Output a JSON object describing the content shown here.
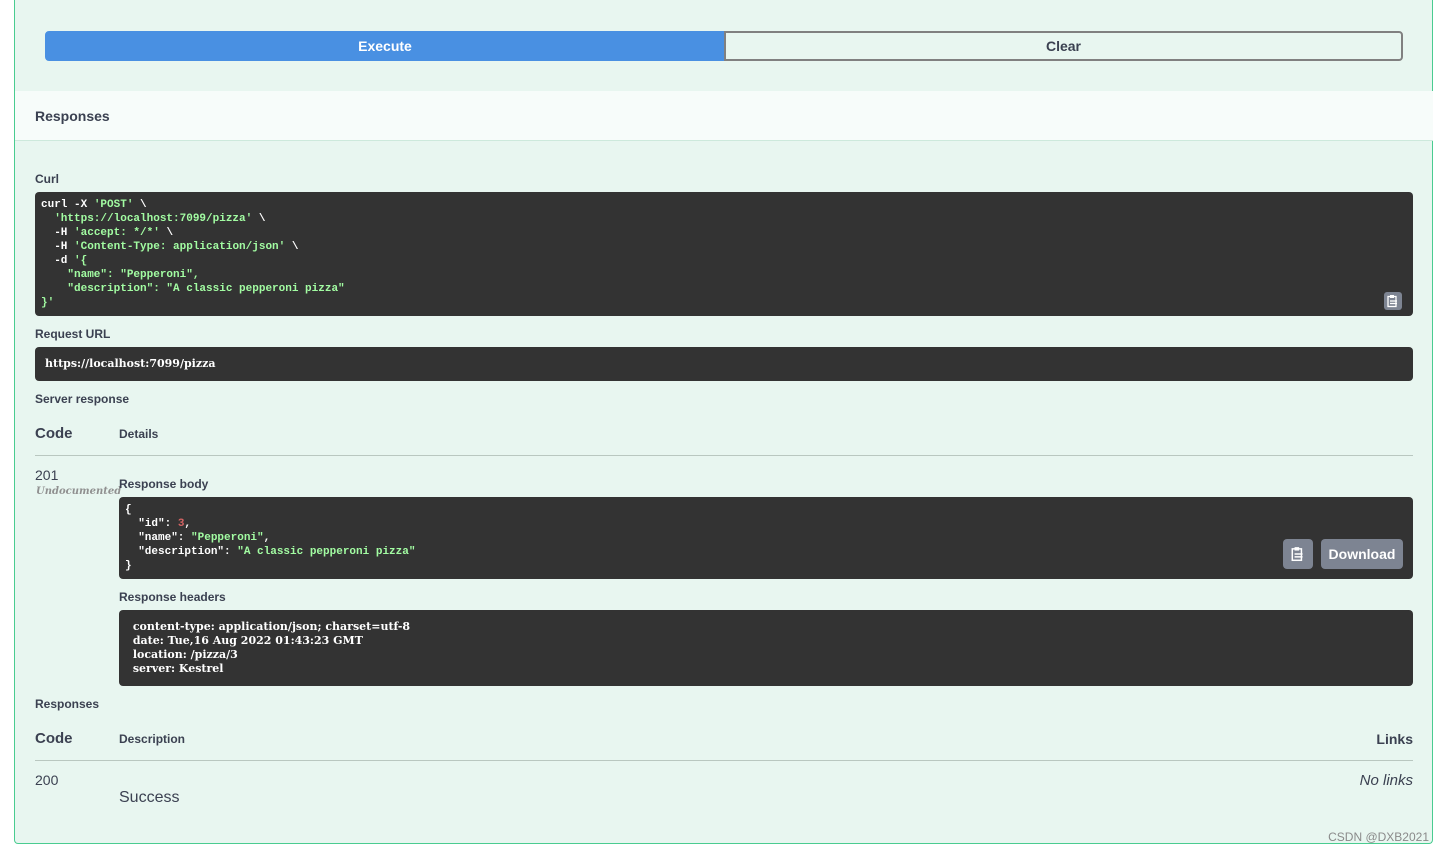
{
  "buttons": {
    "execute": "Execute",
    "clear": "Clear"
  },
  "responses_header": "Responses",
  "curl": {
    "label": "Curl",
    "lines": [
      [
        "curl -X ",
        {
          "s": "'POST'"
        },
        " \\"
      ],
      [
        "  ",
        {
          "s": "'https://localhost:7099/pizza'"
        },
        " \\"
      ],
      [
        "  -H ",
        {
          "s": "'accept: */*'"
        },
        " \\"
      ],
      [
        "  -H ",
        {
          "s": "'Content-Type: application/json'"
        },
        " \\"
      ],
      [
        "  -d ",
        {
          "s": "'{"
        }
      ],
      [
        "    ",
        {
          "s": "\"name\": \"Pepperoni\","
        }
      ],
      [
        "    ",
        {
          "s": "\"description\": \"A classic pepperoni pizza\""
        }
      ],
      [
        {
          "s": "}'"
        }
      ]
    ]
  },
  "request_url": {
    "label": "Request URL",
    "value": "https://localhost:7099/pizza"
  },
  "server_response": {
    "label": "Server response",
    "col_code": "Code",
    "col_details": "Details",
    "code": "201",
    "undocumented": "Undocumented",
    "body_label": "Response body",
    "body_lines": [
      [
        "{"
      ],
      [
        "  \"id\": ",
        {
          "n": "3"
        },
        ","
      ],
      [
        "  \"name\": ",
        {
          "s": "\"Pepperoni\""
        },
        ","
      ],
      [
        "  \"description\": ",
        {
          "s": "\"A classic pepperoni pizza\""
        }
      ],
      [
        "}"
      ]
    ],
    "download": "Download",
    "headers_label": "Response headers",
    "headers_lines": [
      " content-type: application/json; charset=utf-8",
      " date: Tue,16 Aug 2022 01:43:23 GMT",
      " location: /pizza/3",
      " server: Kestrel"
    ]
  },
  "responses": {
    "label": "Responses",
    "col_code": "Code",
    "col_description": "Description",
    "col_links": "Links",
    "code": "200",
    "description": "Success",
    "links": "No links"
  },
  "watermark": "CSDN @DXB2021",
  "icons": {
    "copy": "clipboard-icon"
  }
}
